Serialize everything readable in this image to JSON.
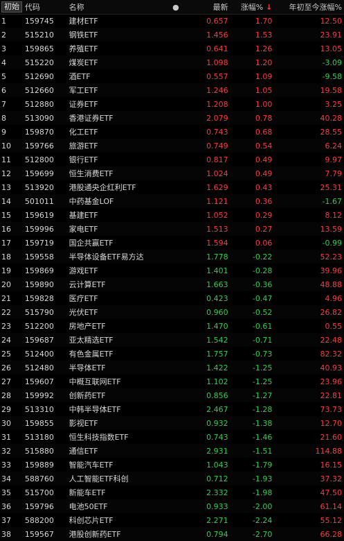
{
  "header": {
    "badge": "初始",
    "code": "代码",
    "name": "名称",
    "dot": "●",
    "last": "最新",
    "chg": "涨幅%",
    "sort_arrow": "↓",
    "ytd": "年初至今涨幅%"
  },
  "colors": {
    "up": "#ff3b3b",
    "down": "#2fd04a",
    "background": "#000000"
  },
  "rows": [
    {
      "idx": "1",
      "code": "159745",
      "name": "建材ETF",
      "last": "0.657",
      "chg": "1.70",
      "ytd": "12.50"
    },
    {
      "idx": "2",
      "code": "515210",
      "name": "钢铁ETF",
      "last": "1.456",
      "chg": "1.53",
      "ytd": "23.91"
    },
    {
      "idx": "3",
      "code": "159865",
      "name": "养殖ETF",
      "last": "0.641",
      "chg": "1.26",
      "ytd": "13.05"
    },
    {
      "idx": "4",
      "code": "515220",
      "name": "煤炭ETF",
      "last": "1.098",
      "chg": "1.20",
      "ytd": "-3.09"
    },
    {
      "idx": "5",
      "code": "512690",
      "name": "酒ETF",
      "last": "0.557",
      "chg": "1.09",
      "ytd": "-9.58"
    },
    {
      "idx": "6",
      "code": "512660",
      "name": "军工ETF",
      "last": "1.246",
      "chg": "1.05",
      "ytd": "19.58"
    },
    {
      "idx": "7",
      "code": "512880",
      "name": "证券ETF",
      "last": "1.208",
      "chg": "1.00",
      "ytd": "3.25"
    },
    {
      "idx": "8",
      "code": "513090",
      "name": "香港证券ETF",
      "last": "2.079",
      "chg": "0.78",
      "ytd": "40.28"
    },
    {
      "idx": "9",
      "code": "159870",
      "name": "化工ETF",
      "last": "0.743",
      "chg": "0.68",
      "ytd": "28.55"
    },
    {
      "idx": "10",
      "code": "159766",
      "name": "旅游ETF",
      "last": "0.749",
      "chg": "0.54",
      "ytd": "6.24"
    },
    {
      "idx": "11",
      "code": "512800",
      "name": "银行ETF",
      "last": "0.817",
      "chg": "0.49",
      "ytd": "9.97"
    },
    {
      "idx": "12",
      "code": "159699",
      "name": "恒生消费ETF",
      "last": "1.024",
      "chg": "0.49",
      "ytd": "7.79"
    },
    {
      "idx": "13",
      "code": "513920",
      "name": "港股通央企红利ETF",
      "last": "1.629",
      "chg": "0.43",
      "ytd": "25.31"
    },
    {
      "idx": "14",
      "code": "501011",
      "name": "中药基金LOF",
      "last": "1.121",
      "chg": "0.36",
      "ytd": "-1.67"
    },
    {
      "idx": "15",
      "code": "159619",
      "name": "基建ETF",
      "last": "1.052",
      "chg": "0.29",
      "ytd": "8.12"
    },
    {
      "idx": "16",
      "code": "159996",
      "name": "家电ETF",
      "last": "1.513",
      "chg": "0.27",
      "ytd": "13.59"
    },
    {
      "idx": "17",
      "code": "159719",
      "name": "国企共赢ETF",
      "last": "1.594",
      "chg": "0.06",
      "ytd": "-0.99"
    },
    {
      "idx": "18",
      "code": "159558",
      "name": "半导体设备ETF易方达",
      "last": "1.778",
      "chg": "-0.22",
      "ytd": "52.23"
    },
    {
      "idx": "19",
      "code": "159869",
      "name": "游戏ETF",
      "last": "1.401",
      "chg": "-0.28",
      "ytd": "39.96"
    },
    {
      "idx": "20",
      "code": "159890",
      "name": "云计算ETF",
      "last": "1.663",
      "chg": "-0.36",
      "ytd": "48.88"
    },
    {
      "idx": "21",
      "code": "159828",
      "name": "医疗ETF",
      "last": "0.423",
      "chg": "-0.47",
      "ytd": "4.96"
    },
    {
      "idx": "22",
      "code": "515790",
      "name": "光伏ETF",
      "last": "0.960",
      "chg": "-0.52",
      "ytd": "26.82"
    },
    {
      "idx": "23",
      "code": "512200",
      "name": "房地产ETF",
      "last": "1.470",
      "chg": "-0.61",
      "ytd": "0.55"
    },
    {
      "idx": "24",
      "code": "159687",
      "name": "亚太精选ETF",
      "last": "1.542",
      "chg": "-0.71",
      "ytd": "22.48"
    },
    {
      "idx": "25",
      "code": "512400",
      "name": "有色金属ETF",
      "last": "1.757",
      "chg": "-0.73",
      "ytd": "82.32"
    },
    {
      "idx": "26",
      "code": "512480",
      "name": "半导体ETF",
      "last": "1.422",
      "chg": "-1.25",
      "ytd": "40.93"
    },
    {
      "idx": "27",
      "code": "159607",
      "name": "中概互联网ETF",
      "last": "1.102",
      "chg": "-1.25",
      "ytd": "23.96"
    },
    {
      "idx": "28",
      "code": "159992",
      "name": "创新药ETF",
      "last": "0.856",
      "chg": "-1.27",
      "ytd": "22.81"
    },
    {
      "idx": "29",
      "code": "513310",
      "name": "中韩半导体ETF",
      "last": "2.467",
      "chg": "-1.28",
      "ytd": "73.73"
    },
    {
      "idx": "30",
      "code": "159855",
      "name": "影视ETF",
      "last": "0.932",
      "chg": "-1.38",
      "ytd": "12.70"
    },
    {
      "idx": "31",
      "code": "513180",
      "name": "恒生科技指数ETF",
      "last": "0.743",
      "chg": "-1.46",
      "ytd": "21.60"
    },
    {
      "idx": "32",
      "code": "515880",
      "name": "通信ETF",
      "last": "2.931",
      "chg": "-1.51",
      "ytd": "114.88"
    },
    {
      "idx": "33",
      "code": "159889",
      "name": "智能汽车ETF",
      "last": "1.043",
      "chg": "-1.79",
      "ytd": "16.15"
    },
    {
      "idx": "34",
      "code": "588760",
      "name": "人工智能ETF科创",
      "last": "0.712",
      "chg": "-1.93",
      "ytd": "37.32"
    },
    {
      "idx": "35",
      "code": "515700",
      "name": "新能车ETF",
      "last": "2.332",
      "chg": "-1.98",
      "ytd": "47.50"
    },
    {
      "idx": "36",
      "code": "159796",
      "name": "电池50ETF",
      "last": "0.933",
      "chg": "-2.00",
      "ytd": "61.14"
    },
    {
      "idx": "37",
      "code": "588200",
      "name": "科创芯片ETF",
      "last": "2.271",
      "chg": "-2.24",
      "ytd": "55.12"
    },
    {
      "idx": "38",
      "code": "159567",
      "name": "港股创新药ETF",
      "last": "0.794",
      "chg": "-2.70",
      "ytd": "66.28"
    }
  ]
}
